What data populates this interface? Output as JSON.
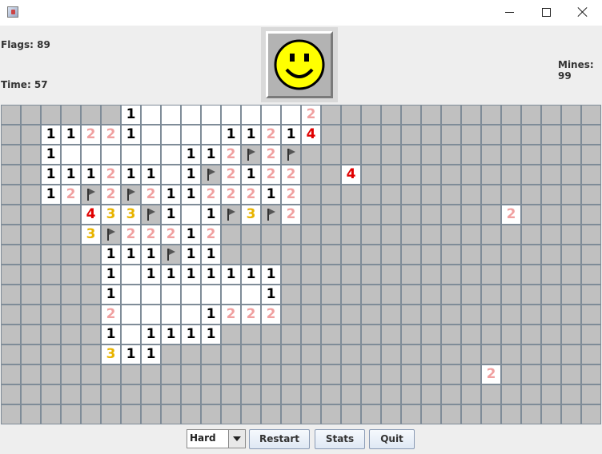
{
  "window": {
    "icon": "java-cup-icon"
  },
  "info": {
    "flags_label": "Flags: 89",
    "time_label": "Time: 57",
    "mines_label": "Mines: 99"
  },
  "face": {
    "state": "smile"
  },
  "colors": {
    "hidden": "#c0c0c0",
    "open": "#ffffff",
    "grid_line": "#7f8c98",
    "n1": "#000000",
    "n2": "#f0a0a0",
    "n3": "#e8b400",
    "n4": "#e00000",
    "flag": "#555555"
  },
  "board": {
    "rows": 16,
    "cols": 30,
    "cells": [
      [
        [
          6,
          0,
          1
        ]
      ],
      [
        [
          6,
          0,
          1
        ],
        [
          7,
          0,
          ""
        ],
        [
          8,
          0,
          ""
        ],
        [
          9,
          0,
          ""
        ],
        [
          10,
          0,
          ""
        ],
        [
          11,
          0,
          ""
        ],
        [
          12,
          0,
          ""
        ],
        [
          13,
          0,
          ""
        ],
        [
          14,
          0,
          ""
        ],
        [
          15,
          0,
          2
        ]
      ],
      [
        [
          2,
          1,
          1
        ],
        [
          3,
          1,
          1
        ],
        [
          4,
          1,
          2
        ],
        [
          5,
          1,
          2
        ],
        [
          6,
          1,
          1
        ],
        [
          7,
          1,
          ""
        ],
        [
          8,
          1,
          ""
        ],
        [
          9,
          1,
          ""
        ],
        [
          10,
          1,
          ""
        ],
        [
          11,
          1,
          1
        ],
        [
          12,
          1,
          1
        ],
        [
          13,
          1,
          2
        ],
        [
          14,
          1,
          1
        ],
        [
          15,
          1,
          4
        ]
      ],
      [
        [
          2,
          2,
          1
        ],
        [
          3,
          2,
          ""
        ],
        [
          4,
          2,
          ""
        ],
        [
          5,
          2,
          ""
        ],
        [
          6,
          2,
          ""
        ],
        [
          7,
          2,
          ""
        ],
        [
          8,
          2,
          ""
        ],
        [
          9,
          2,
          1
        ],
        [
          10,
          2,
          1
        ],
        [
          11,
          2,
          2
        ],
        [
          12,
          2,
          "F"
        ],
        [
          13,
          2,
          2
        ],
        [
          14,
          2,
          "F"
        ]
      ],
      [
        [
          2,
          3,
          1
        ],
        [
          3,
          3,
          1
        ],
        [
          4,
          3,
          1
        ],
        [
          5,
          3,
          2
        ],
        [
          6,
          3,
          1
        ],
        [
          7,
          3,
          1
        ],
        [
          8,
          3,
          ""
        ],
        [
          9,
          3,
          1
        ],
        [
          10,
          3,
          "F"
        ],
        [
          11,
          3,
          2
        ],
        [
          12,
          3,
          1
        ],
        [
          13,
          3,
          2
        ],
        [
          14,
          3,
          2
        ],
        [
          17,
          3,
          4
        ]
      ],
      [
        [
          2,
          4,
          1
        ],
        [
          3,
          4,
          2
        ],
        [
          4,
          4,
          "F"
        ],
        [
          5,
          4,
          2
        ],
        [
          6,
          4,
          "F"
        ],
        [
          7,
          4,
          2
        ],
        [
          8,
          4,
          1
        ],
        [
          9,
          4,
          1
        ],
        [
          10,
          4,
          2
        ],
        [
          11,
          4,
          2
        ],
        [
          12,
          4,
          2
        ],
        [
          13,
          4,
          1
        ],
        [
          14,
          4,
          2
        ]
      ],
      [
        [
          4,
          5,
          4
        ],
        [
          5,
          5,
          3
        ],
        [
          6,
          5,
          3
        ],
        [
          7,
          5,
          "F"
        ],
        [
          8,
          5,
          1
        ],
        [
          9,
          5,
          ""
        ],
        [
          10,
          5,
          1
        ],
        [
          11,
          5,
          "F"
        ],
        [
          12,
          5,
          3
        ],
        [
          13,
          5,
          "F"
        ],
        [
          14,
          5,
          2
        ],
        [
          25,
          5,
          2
        ]
      ],
      [
        [
          4,
          6,
          3
        ],
        [
          5,
          6,
          "F"
        ],
        [
          6,
          6,
          2
        ],
        [
          7,
          6,
          2
        ],
        [
          8,
          6,
          2
        ],
        [
          9,
          6,
          1
        ],
        [
          10,
          6,
          2
        ]
      ],
      [
        [
          5,
          7,
          1
        ],
        [
          6,
          7,
          1
        ],
        [
          7,
          7,
          1
        ],
        [
          8,
          7,
          "F"
        ],
        [
          9,
          7,
          1
        ],
        [
          10,
          7,
          1
        ]
      ],
      [
        [
          5,
          8,
          1
        ],
        [
          6,
          8,
          ""
        ],
        [
          7,
          8,
          1
        ],
        [
          8,
          8,
          1
        ],
        [
          9,
          8,
          1
        ],
        [
          10,
          8,
          1
        ],
        [
          11,
          8,
          1
        ],
        [
          12,
          8,
          1
        ],
        [
          13,
          8,
          1
        ]
      ],
      [
        [
          5,
          9,
          1
        ],
        [
          6,
          9,
          ""
        ],
        [
          7,
          9,
          ""
        ],
        [
          8,
          9,
          ""
        ],
        [
          9,
          9,
          ""
        ],
        [
          10,
          9,
          ""
        ],
        [
          11,
          9,
          ""
        ],
        [
          12,
          9,
          ""
        ],
        [
          13,
          9,
          1
        ]
      ],
      [
        [
          5,
          10,
          2
        ],
        [
          6,
          10,
          ""
        ],
        [
          7,
          10,
          ""
        ],
        [
          8,
          10,
          ""
        ],
        [
          9,
          10,
          ""
        ],
        [
          10,
          10,
          1
        ],
        [
          11,
          10,
          2
        ],
        [
          12,
          10,
          2
        ],
        [
          13,
          10,
          2
        ]
      ],
      [
        [
          5,
          11,
          1
        ],
        [
          6,
          11,
          ""
        ],
        [
          7,
          11,
          1
        ],
        [
          8,
          11,
          1
        ],
        [
          9,
          11,
          1
        ],
        [
          10,
          11,
          1
        ]
      ],
      [
        [
          5,
          12,
          3
        ],
        [
          6,
          12,
          1
        ],
        [
          7,
          12,
          1
        ]
      ],
      [
        [
          24,
          13,
          2
        ]
      ]
    ]
  },
  "controls": {
    "difficulty": "Hard",
    "restart": "Restart",
    "stats": "Stats",
    "quit": "Quit"
  }
}
